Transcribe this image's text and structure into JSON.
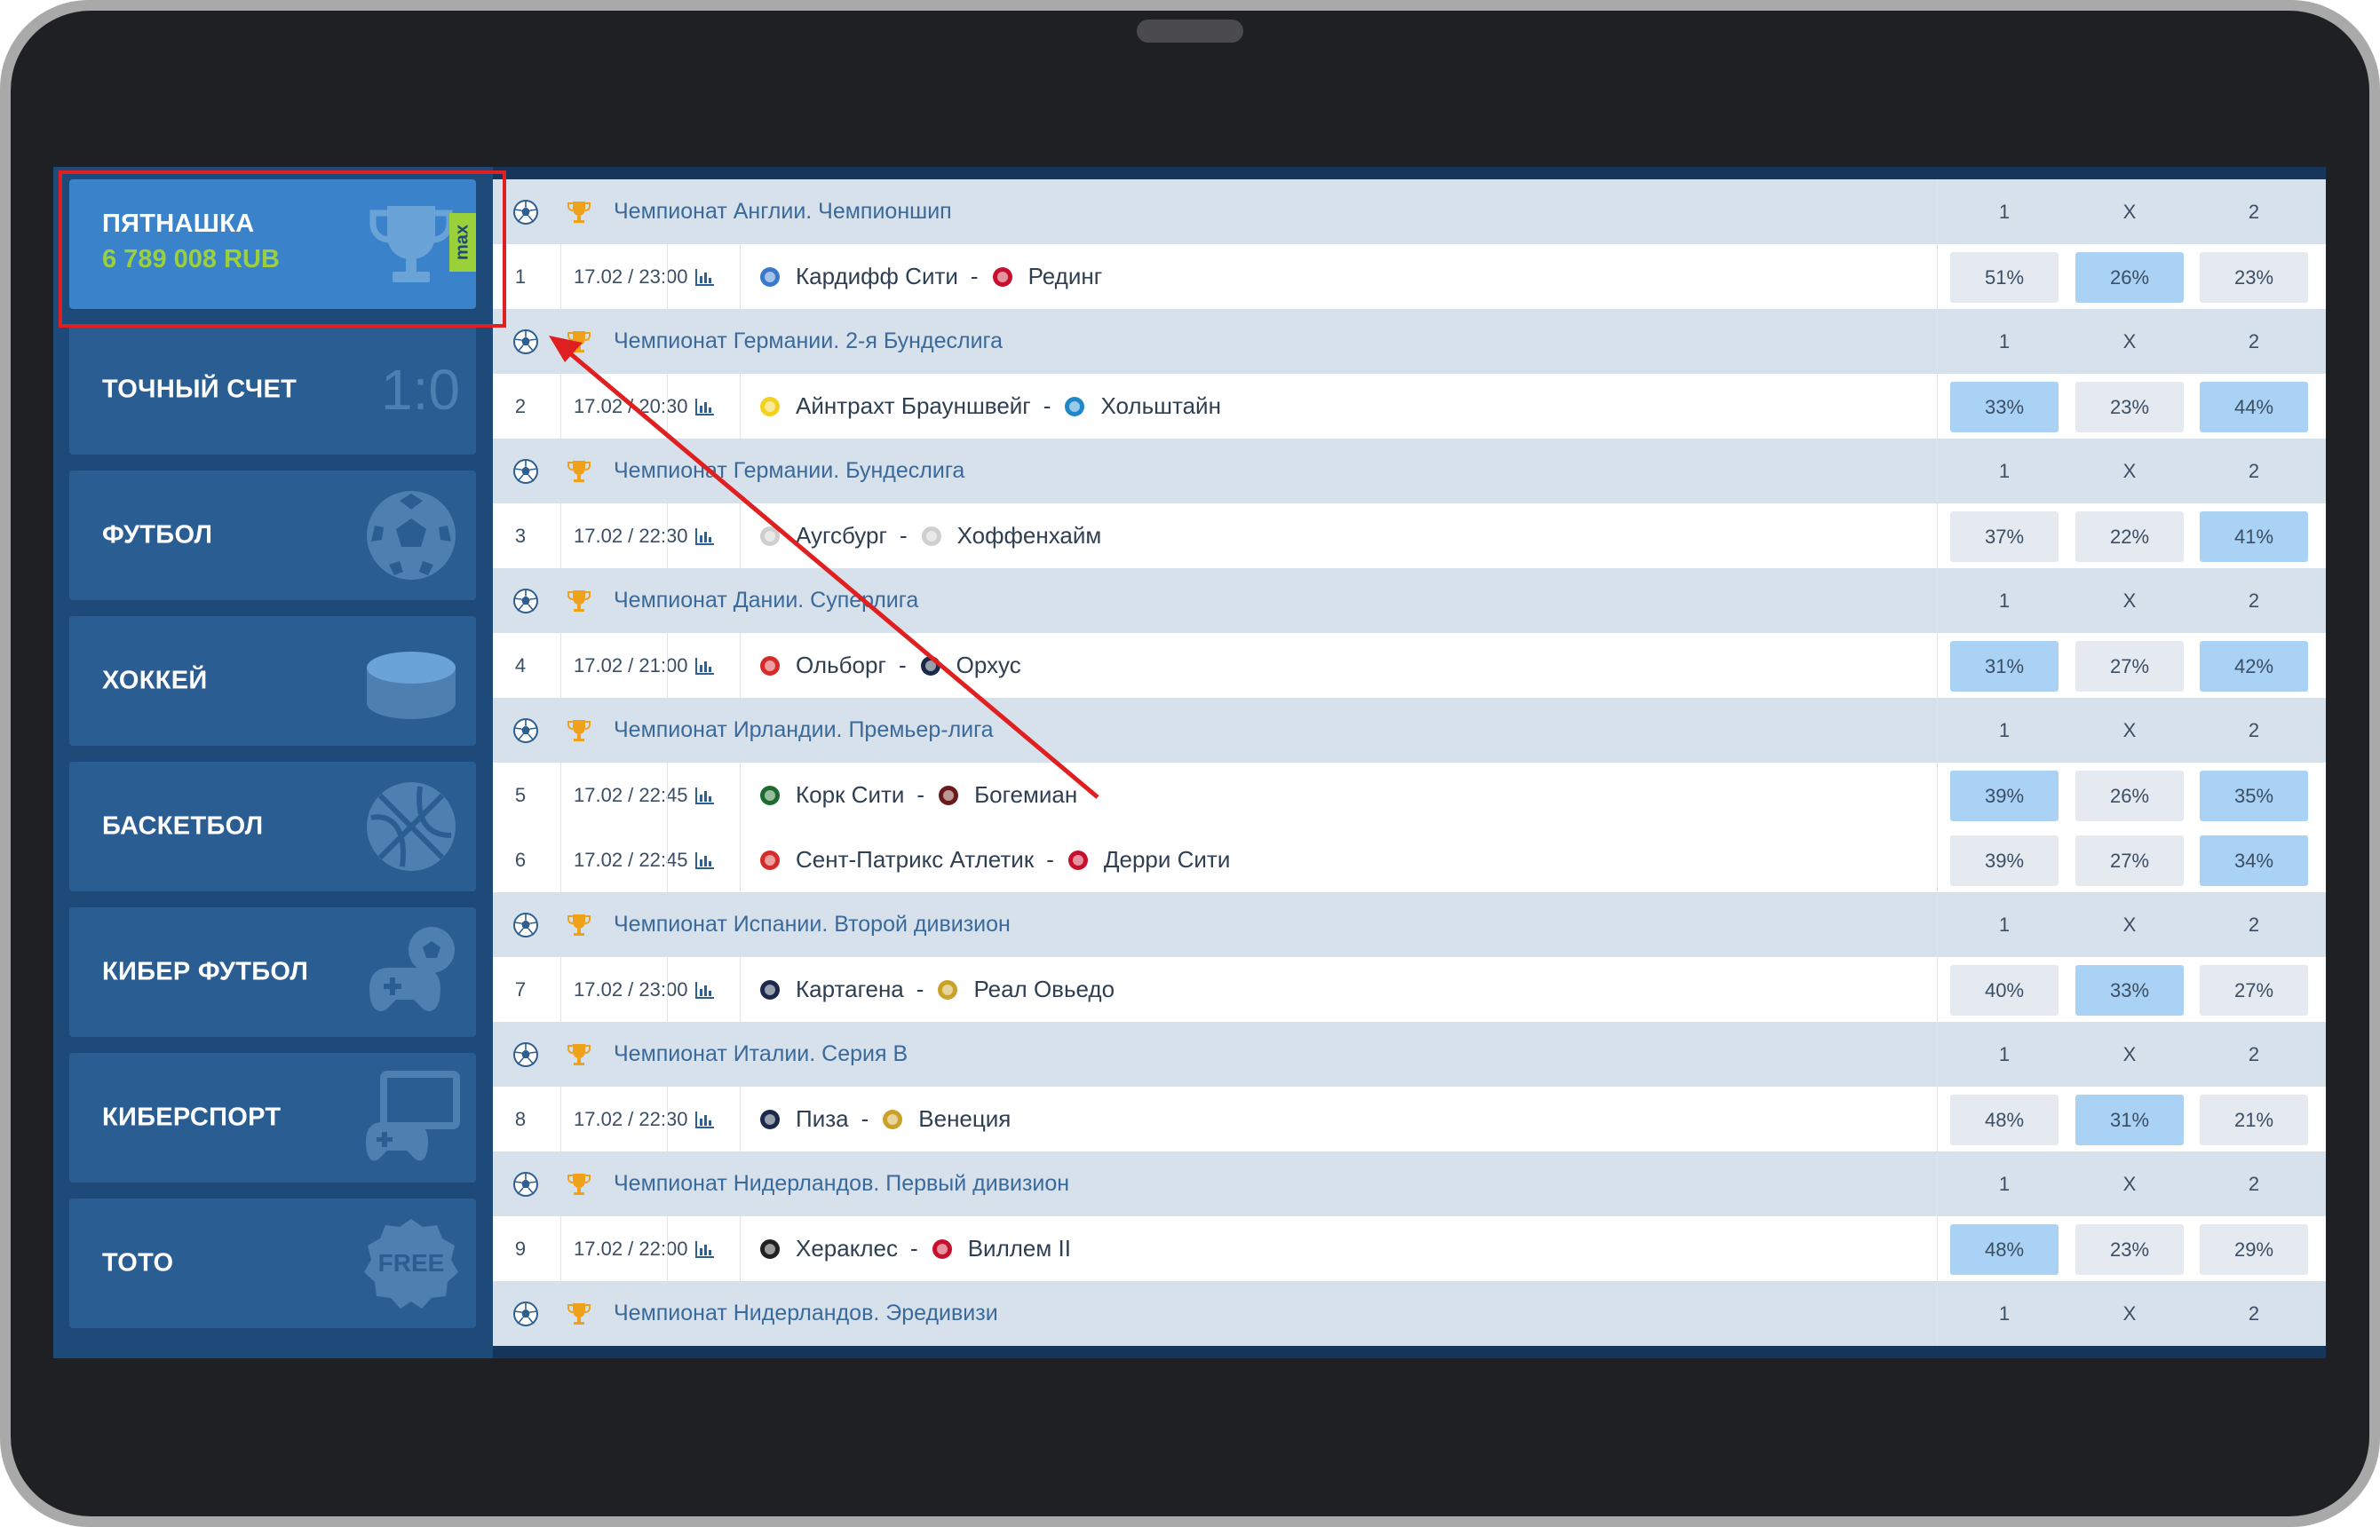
{
  "sidebar": {
    "items": [
      {
        "label": "ПЯТНАШКА",
        "amount": "6 789 008 RUB",
        "badge": "max",
        "icon": "trophy-icon",
        "active": true
      },
      {
        "label": "ТОЧНЫЙ СЧЕТ",
        "icon_text": "1:0",
        "icon": "score-icon"
      },
      {
        "label": "ФУТБОЛ",
        "icon": "soccer-ball-icon"
      },
      {
        "label": "ХОККЕЙ",
        "icon": "hockey-puck-icon"
      },
      {
        "label": "БАСКЕТБОЛ",
        "icon": "basketball-icon"
      },
      {
        "label": "КИБЕР ФУТБОЛ",
        "icon": "gamepad-ball-icon"
      },
      {
        "label": "КИБЕРСПОРТ",
        "icon": "monitor-gamepad-icon"
      },
      {
        "label": "ТОТО",
        "icon_text": "FREE",
        "icon": "free-badge-icon"
      }
    ]
  },
  "odds_headers": {
    "h1": "1",
    "hX": "X",
    "h2": "2"
  },
  "leagues": [
    {
      "name": "Чемпионат Англии. Чемпионшип",
      "matches": [
        {
          "n": "1",
          "date": "17.02 / 23:00",
          "home": "Кардифф Сити",
          "away": "Рединг",
          "p1": "51%",
          "pX": "26%",
          "p2": "23%",
          "hi": "X",
          "home_color": "#3a79c9",
          "away_color": "#c8102e"
        }
      ]
    },
    {
      "name": "Чемпионат Германии. 2-я Бундеслига",
      "matches": [
        {
          "n": "2",
          "date": "17.02 / 20:30",
          "home": "Айнтрахт Брауншвейг",
          "away": "Хольштайн",
          "p1": "33%",
          "pX": "23%",
          "p2": "44%",
          "hi": "1,2",
          "home_color": "#f2d21e",
          "away_color": "#1e88c8"
        }
      ]
    },
    {
      "name": "Чемпионат Германии. Бундеслига",
      "matches": [
        {
          "n": "3",
          "date": "17.02 / 22:30",
          "home": "Аугсбург",
          "away": "Хоффенхайм",
          "p1": "37%",
          "pX": "22%",
          "p2": "41%",
          "hi": "2",
          "home_color": "#cfcfcf",
          "away_color": "#cfcfcf"
        }
      ]
    },
    {
      "name": "Чемпионат Дании. Суперлига",
      "matches": [
        {
          "n": "4",
          "date": "17.02 / 21:00",
          "home": "Ольборг",
          "away": "Орхус",
          "p1": "31%",
          "pX": "27%",
          "p2": "42%",
          "hi": "1,2",
          "home_color": "#d62b2b",
          "away_color": "#1b2a4a"
        }
      ]
    },
    {
      "name": "Чемпионат Ирландии. Премьер-лига",
      "matches": [
        {
          "n": "5",
          "date": "17.02 / 22:45",
          "home": "Корк Сити",
          "away": "Богемиан",
          "p1": "39%",
          "pX": "26%",
          "p2": "35%",
          "hi": "1,2",
          "home_color": "#1d6b2e",
          "away_color": "#6b1a1a"
        },
        {
          "n": "6",
          "date": "17.02 / 22:45",
          "home": "Сент-Патрикс Атлетик",
          "away": "Дерри Сити",
          "p1": "39%",
          "pX": "27%",
          "p2": "34%",
          "hi": "2",
          "home_color": "#d62b2b",
          "away_color": "#c8102e"
        }
      ]
    },
    {
      "name": "Чемпионат Испании. Второй дивизион",
      "matches": [
        {
          "n": "7",
          "date": "17.02 / 23:00",
          "home": "Картагена",
          "away": "Реал Овьедо",
          "p1": "40%",
          "pX": "33%",
          "p2": "27%",
          "hi": "X",
          "home_color": "#1b2a4a",
          "away_color": "#c9a227"
        }
      ]
    },
    {
      "name": "Чемпионат Италии. Серия В",
      "matches": [
        {
          "n": "8",
          "date": "17.02 / 22:30",
          "home": "Пиза",
          "away": "Венеция",
          "p1": "48%",
          "pX": "31%",
          "p2": "21%",
          "hi": "X",
          "home_color": "#1b2a4a",
          "away_color": "#c9a227"
        }
      ]
    },
    {
      "name": "Чемпионат Нидерландов. Первый дивизион",
      "matches": [
        {
          "n": "9",
          "date": "17.02 / 22:00",
          "home": "Хераклес",
          "away": "Виллем II",
          "p1": "48%",
          "pX": "23%",
          "p2": "29%",
          "hi": "1",
          "home_color": "#222222",
          "away_color": "#c8102e"
        }
      ]
    },
    {
      "name": "Чемпионат Нидерландов. Эредивизи",
      "matches": []
    }
  ],
  "colors": {
    "accent_active": "#3a83cb",
    "sidebar_bg": "#1d4a78",
    "league_bg": "#d7e1eb",
    "odd_highlight": "#a9d2f5",
    "annotation": "#e02020",
    "amount_green": "#9ad03a"
  }
}
